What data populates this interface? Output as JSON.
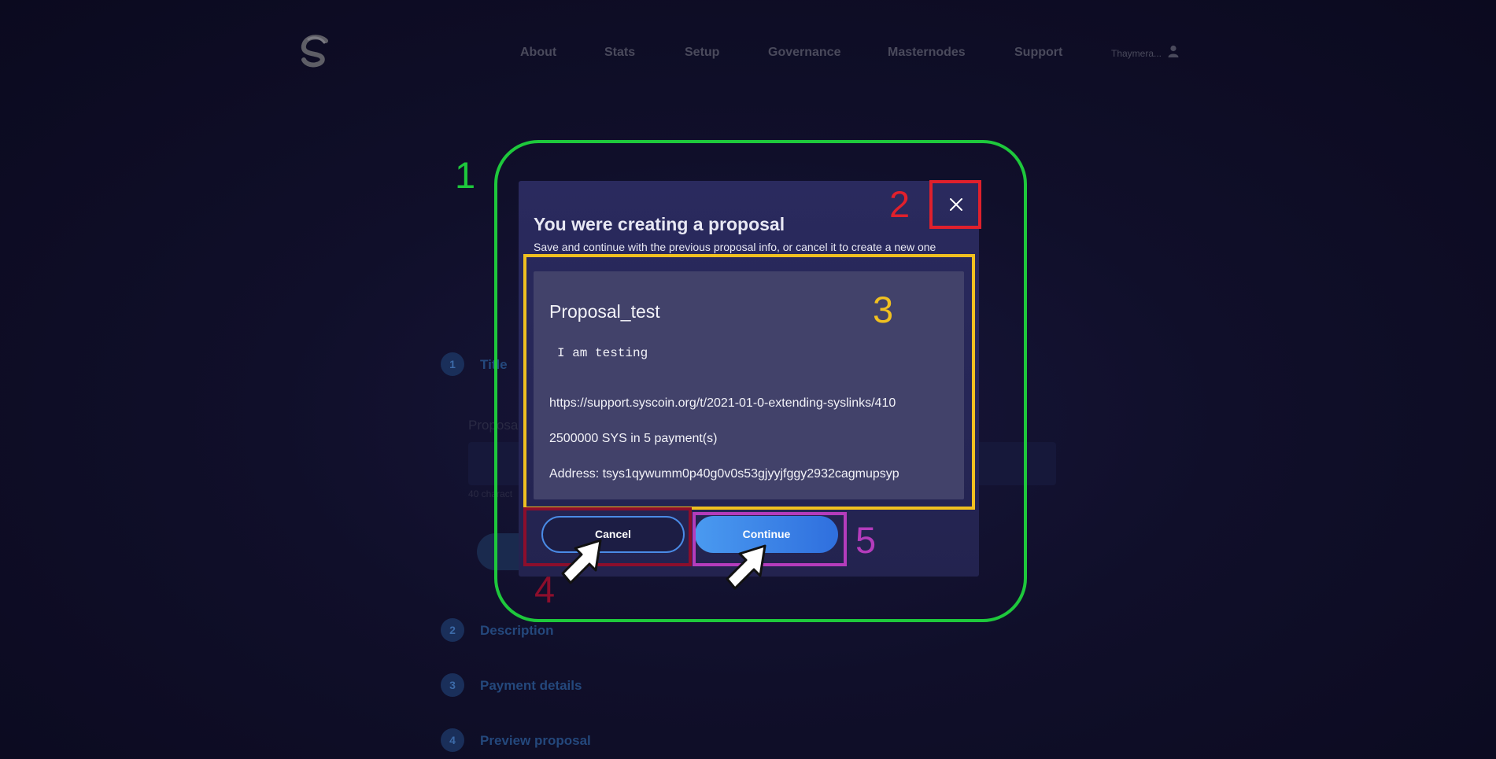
{
  "nav": {
    "items": [
      "About",
      "Stats",
      "Setup",
      "Governance",
      "Masternodes",
      "Support"
    ],
    "user": "Thaymera..."
  },
  "steps": [
    {
      "num": "1",
      "label": "Title"
    },
    {
      "num": "2",
      "label": "Description"
    },
    {
      "num": "3",
      "label": "Payment details"
    },
    {
      "num": "4",
      "label": "Preview proposal"
    }
  ],
  "background_form": {
    "field_label": "Proposa",
    "hint": "40 charact"
  },
  "modal": {
    "title": "You were creating a proposal",
    "subtitle": "Save and continue with the previous proposal info, or cancel it to create a new one",
    "preview": {
      "title": "Proposal_test",
      "description": "I am testing",
      "url": "https://support.syscoin.org/t/2021-01-0-extending-syslinks/410",
      "amount": "2500000 SYS in 5 payment(s)",
      "address": "Address: tsys1qywumm0p40g0v0s53gjyyjfggy2932cagmupsyp"
    },
    "cancel_label": "Cancel",
    "continue_label": "Continue"
  },
  "annotations": {
    "labels": [
      "1",
      "2",
      "3",
      "4",
      "5"
    ],
    "colors": [
      "#1ec83c",
      "#e0202c",
      "#f0c020",
      "#8c0e2c",
      "#b43cbc"
    ]
  },
  "colors": {
    "page_bg": "#0d0c22",
    "modal_bg": "#2a2a5e",
    "card_bg": "#42426a",
    "accent_blue": "#4a8be6"
  }
}
